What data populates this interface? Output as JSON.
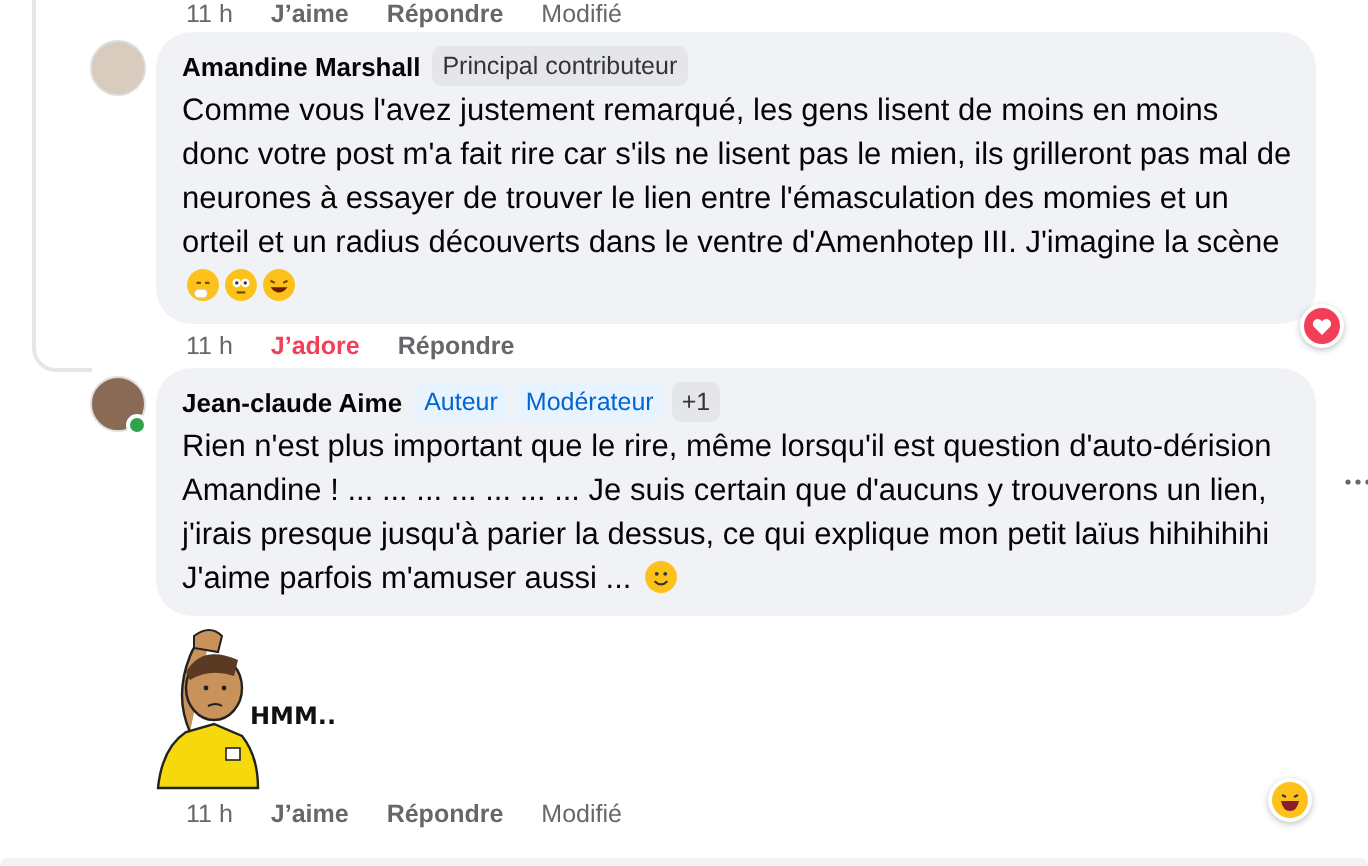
{
  "previous_footer": {
    "time": "11 h",
    "like": "J’aime",
    "liked": false,
    "reply": "Répondre",
    "edited": "Modifié"
  },
  "comments": [
    {
      "author": "Amandine Marshall",
      "badges": [
        {
          "label": "Principal contributeur",
          "kind": "contributor"
        }
      ],
      "text": "Comme vous l'avez justement remarqué, les gens lisent de moins en moins donc votre post m'a fait rire car s'ils ne lisent pas le mien, ils grilleront pas mal de neurones à essayer de trouver le lien entre l'émasculation des momies et un orteil et un radius découverts dans le ventre d'Amenhotep III. J'imagine la scène",
      "online": false,
      "more": false,
      "footer": {
        "time": "11 h",
        "like": "J’adore",
        "liked": true,
        "reply": "Répondre"
      }
    },
    {
      "author": "Jean-claude Aime",
      "badges": [
        {
          "label": "Auteur",
          "kind": "role"
        },
        {
          "label": "Modérateur",
          "kind": "role"
        },
        {
          "label": "+1",
          "kind": "count"
        }
      ],
      "text": "Rien n'est plus important que le rire, même lorsqu'il est question d'auto-dérision Amandine ! ... ... ... ... ... ... ... Je suis certain que d'aucuns y trouverons un lien, j'irais presque jusqu'à parier la dessus, ce qui explique mon petit laïus hihihihihi J'aime parfois m'amuser aussi ...",
      "online": true,
      "more": true,
      "sticker": {
        "caption": "HMM.."
      },
      "footer": {
        "time": "11 h",
        "like": "J’aime",
        "liked": false,
        "reply": "Répondre",
        "edited": "Modifié"
      }
    }
  ]
}
